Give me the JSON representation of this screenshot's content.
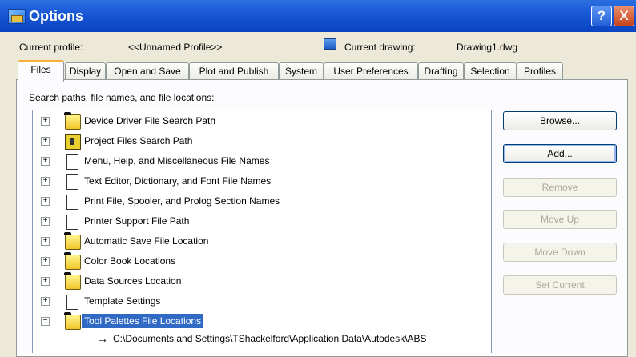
{
  "window": {
    "title": "Options",
    "help_glyph": "?",
    "close_glyph": "X"
  },
  "profile": {
    "current_profile_label": "Current profile:",
    "current_profile_value": "<<Unnamed Profile>>",
    "current_drawing_label": "Current drawing:",
    "current_drawing_value": "Drawing1.dwg"
  },
  "tabs": [
    {
      "label": "Files",
      "active": true
    },
    {
      "label": "Display"
    },
    {
      "label": "Open and Save"
    },
    {
      "label": "Plot and Publish"
    },
    {
      "label": "System"
    },
    {
      "label": "User Preferences"
    },
    {
      "label": "Drafting"
    },
    {
      "label": "Selection"
    },
    {
      "label": "Profiles"
    }
  ],
  "files": {
    "section_label": "Search paths, file names, and file locations:",
    "tree": [
      {
        "label": "Device Driver File Search Path",
        "icon": "folder-search-icon",
        "expander": "+"
      },
      {
        "label": "Project Files Search Path",
        "icon": "book-icon",
        "expander": "+"
      },
      {
        "label": "Menu, Help, and Miscellaneous File Names",
        "icon": "document-icon",
        "expander": "+"
      },
      {
        "label": "Text Editor, Dictionary, and Font File Names",
        "icon": "document-icon",
        "expander": "+"
      },
      {
        "label": "Print File, Spooler, and Prolog Section Names",
        "icon": "document-icon",
        "expander": "+"
      },
      {
        "label": "Printer Support File Path",
        "icon": "document-icon",
        "expander": "+"
      },
      {
        "label": "Automatic Save File Location",
        "icon": "folder-search-icon",
        "expander": "+"
      },
      {
        "label": "Color Book Locations",
        "icon": "folder-search-icon",
        "expander": "+"
      },
      {
        "label": "Data Sources Location",
        "icon": "folder-search-icon",
        "expander": "+"
      },
      {
        "label": "Template Settings",
        "icon": "document-icon",
        "expander": "+"
      },
      {
        "label": "Tool Palettes File Locations",
        "icon": "folder-open-icon",
        "expander": "−",
        "selected": true
      }
    ],
    "child_path": "C:\\Documents and Settings\\TShackelford\\Application Data\\Autodesk\\ABS",
    "child_arrow": "→",
    "scroll_up_glyph": "▲"
  },
  "buttons": {
    "browse": "Browse...",
    "add": "Add...",
    "remove": "Remove",
    "move_up": "Move Up",
    "move_down": "Move Down",
    "set_current": "Set Current"
  },
  "colors": {
    "title_bar": "#1756d6",
    "selection": "#316ac5",
    "dialog_bg": "#ece9d8"
  }
}
